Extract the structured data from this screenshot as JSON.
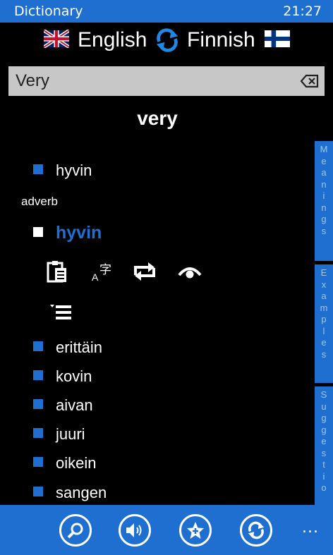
{
  "status": {
    "app_title": "Dictionary",
    "time": "21:27"
  },
  "languages": {
    "source": "English",
    "target": "Finnish"
  },
  "search": {
    "value": "Very"
  },
  "headword": "very",
  "first_translation": "hyvin",
  "part_of_speech": "adverb",
  "highlighted_translation": "hyvin",
  "translations": [
    "erittäin",
    "kovin",
    "aivan",
    "juuri",
    "oikein",
    "sangen"
  ],
  "side_tabs": [
    {
      "label": "Meanings",
      "letters": [
        "M",
        "e",
        "a",
        "n",
        "i",
        "n",
        "g",
        "s"
      ]
    },
    {
      "label": "Examples",
      "letters": [
        "E",
        "x",
        "a",
        "m",
        "p",
        "l",
        "e",
        "s"
      ]
    },
    {
      "label": "Suggestio",
      "letters": [
        "S",
        "u",
        "g",
        "g",
        "e",
        "s",
        "t",
        "i",
        "o"
      ]
    }
  ],
  "appbar": {
    "more_label": "..."
  },
  "colors": {
    "accent": "#1e6fd0",
    "background": "#000000",
    "search_bg": "#c7c7c7"
  }
}
